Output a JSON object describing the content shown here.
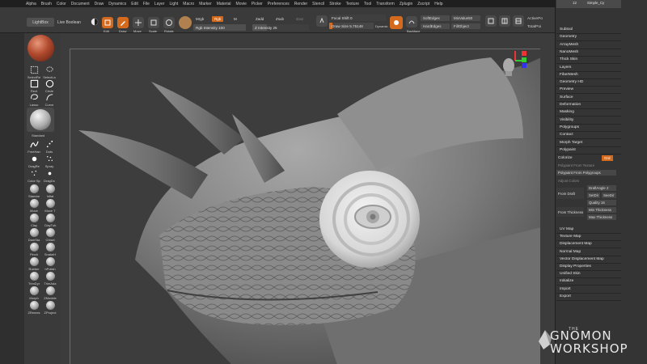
{
  "menu": [
    "Alpha",
    "Brush",
    "Color",
    "Document",
    "Draw",
    "Dynamics",
    "Edit",
    "File",
    "Layer",
    "Light",
    "Macro",
    "Marker",
    "Material",
    "Movie",
    "Picker",
    "Preferences",
    "Render",
    "Stencil",
    "Stroke",
    "Texture",
    "Tool",
    "Transform",
    "Zplugin",
    "Zscript",
    "Help"
  ],
  "shelf": {
    "lightbox": "LightBox",
    "live_boolean": "Live Boolean",
    "edit": "Edit",
    "draw": "Draw",
    "move": "Move",
    "scale": "Scale",
    "rotate": "Rotate",
    "mrgb": "Mrgb",
    "rgb": "Rgb",
    "m": "M",
    "rgb_intensity": "Rgb Intensity 100",
    "zadd": "Zadd",
    "zsub": "Zsub",
    "zcut": "Zcut",
    "z_intensity": "Z Intensity 25",
    "focal_shift": "Focal Shift 0",
    "draw_size": "Draw Size 5.75148",
    "dynamic": "Dynamic",
    "backface": "Backface",
    "softedges": "SoftEdges",
    "hardedges": "HardEdges",
    "mixvalue": "MixValue50",
    "fillobject": "FillObject",
    "activepoints": "ActivePo",
    "totalpoints": "TotalPoi"
  },
  "left": {
    "select_rect": "SelectRe",
    "select_lasso": "SelectLa",
    "rect": "Rect",
    "circle": "Circle",
    "lasso": "Lasso",
    "curve": "Curve",
    "standard": "Standard",
    "freehand": "FreeHan",
    "dots": "Dots",
    "dragrect": "DragRe",
    "spray": "Spray",
    "colorspray": "Color Sp",
    "dragdot": "DragDo",
    "brushes": [
      [
        "Standar",
        "Inflat"
      ],
      [
        "Move",
        "Move T"
      ],
      [
        "Clay",
        "ClayTub"
      ],
      [
        "DamSta",
        "Chisel"
      ],
      [
        "Pinch",
        "SnakeH"
      ],
      [
        "Rubber",
        "hPolish"
      ],
      [
        "TrimDyr",
        "TrimAda"
      ],
      [
        "Morph",
        "ZModele"
      ],
      [
        "ZRemes",
        "ZProject"
      ]
    ]
  },
  "right": {
    "subtool_label": "Simple_Cy",
    "subtool_count": "12",
    "items_top": [
      "Subtool",
      "Geometry",
      "ArrayMesh",
      "NanoMesh",
      "Thick Skin",
      "Layers",
      "FiberMesh",
      "Geometry HD",
      "Preview",
      "Surface",
      "Deformation",
      "Masking",
      "Visibility",
      "Polygroups",
      "Contact",
      "Morph Target",
      "Polypaint"
    ],
    "colorize": "Colorize",
    "grd": "Grd",
    "polypaint_from_texture": "Polypaint From Texture",
    "polypaint_from_polygroups": "Polypaint From Polygroups",
    "adjust_colors": "Adjust Colors",
    "from_draft": "From Draft",
    "draft_angle": "DraftAngle 2",
    "set_dir": "SetDir",
    "see_dir": "SeeDir",
    "quality": "Quality 16",
    "from_thickness": "From Thickness",
    "min_thickness": "Min Thickness",
    "max_thickness": "Max Thickness",
    "items_bottom": [
      "UV Map",
      "Texture Map",
      "Displacement Map",
      "Normal Map",
      "Vector Displacement Map",
      "Display Properties",
      "Unified Skin",
      "Initialize",
      "Import",
      "Export"
    ]
  },
  "logo": {
    "the": "THE",
    "line1": "GNOMON",
    "line2": "WORKSHOP"
  },
  "colors": {
    "accent": "#d46a1e",
    "panel": "#3a3a3a",
    "canvas": "#3d3d3d"
  }
}
